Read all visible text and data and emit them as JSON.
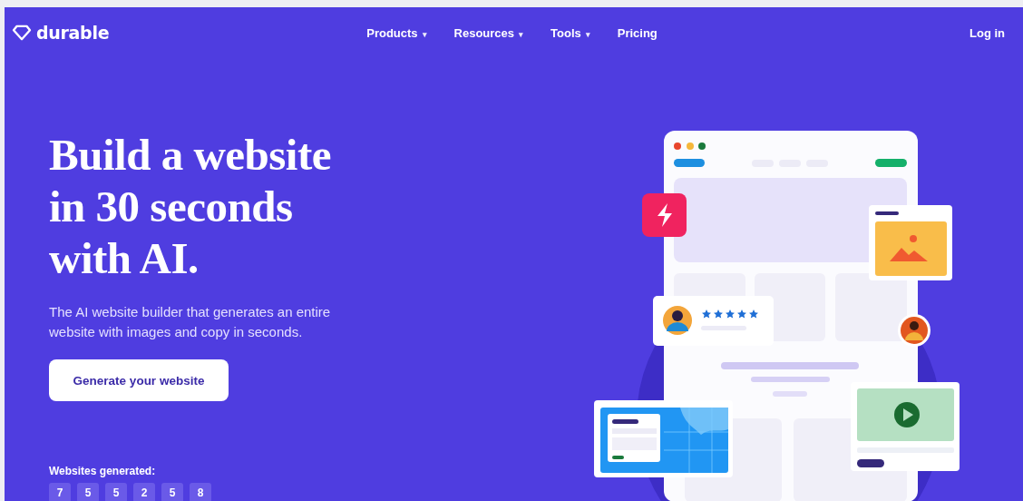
{
  "nav": {
    "logo": "durable",
    "items": [
      {
        "label": "Products",
        "dropdown": true
      },
      {
        "label": "Resources",
        "dropdown": true
      },
      {
        "label": "Tools",
        "dropdown": true
      },
      {
        "label": "Pricing",
        "dropdown": false
      }
    ],
    "dropdown_mark": "▾",
    "login": "Log in"
  },
  "hero": {
    "heading_lines": [
      "Build a website",
      "in 30 seconds",
      "with AI."
    ],
    "subtitle": "The AI website builder that generates an entire website with images and copy in seconds.",
    "button": "Generate your website"
  },
  "counter": {
    "label": "Websites generated:",
    "digits": [
      "7",
      "5",
      "5",
      "2",
      "5",
      "8"
    ]
  }
}
